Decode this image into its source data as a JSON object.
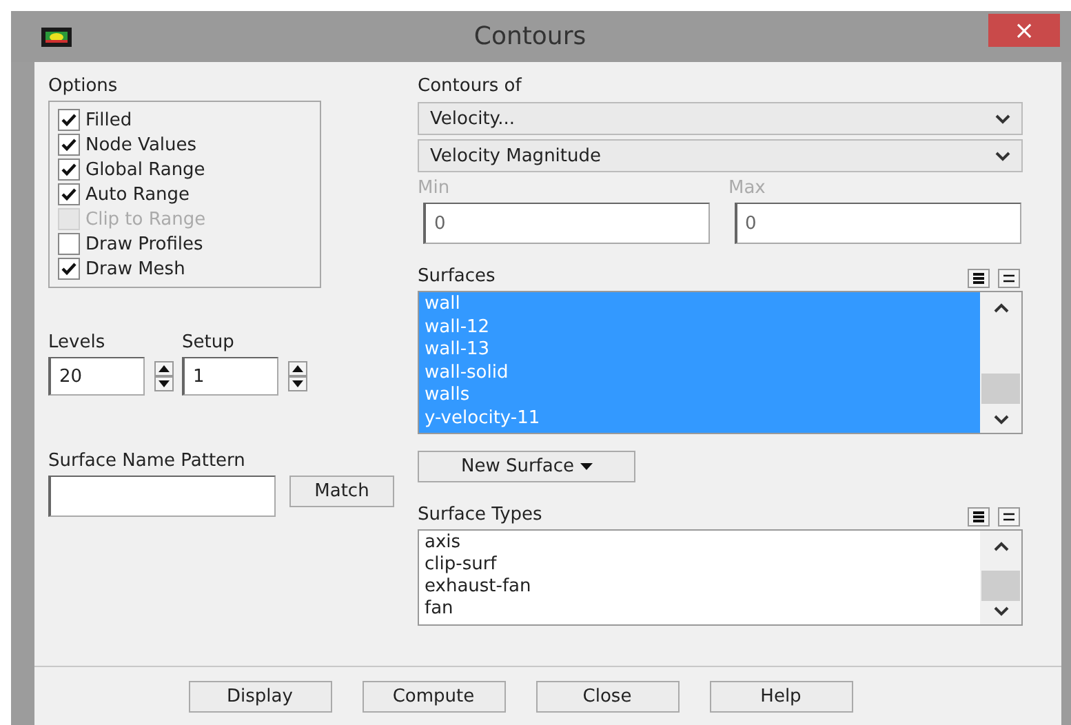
{
  "window": {
    "title": "Contours",
    "close": "×"
  },
  "options": {
    "label": "Options",
    "items": [
      {
        "label": "Filled",
        "checked": true,
        "disabled": false
      },
      {
        "label": "Node Values",
        "checked": true,
        "disabled": false
      },
      {
        "label": "Global Range",
        "checked": true,
        "disabled": false
      },
      {
        "label": "Auto Range",
        "checked": true,
        "disabled": false
      },
      {
        "label": "Clip to Range",
        "checked": false,
        "disabled": true
      },
      {
        "label": "Draw Profiles",
        "checked": false,
        "disabled": false
      },
      {
        "label": "Draw Mesh",
        "checked": true,
        "disabled": false
      }
    ]
  },
  "levels": {
    "label": "Levels",
    "value": "20"
  },
  "setup": {
    "label": "Setup",
    "value": "1"
  },
  "surface_name_pattern": {
    "label": "Surface Name Pattern",
    "button": "Match"
  },
  "contours_of": {
    "label": "Contours of",
    "quantity": "Velocity...",
    "component": "Velocity Magnitude"
  },
  "min": {
    "label": "Min",
    "value": "0"
  },
  "max": {
    "label": "Max",
    "value": "0"
  },
  "surfaces": {
    "label": "Surfaces",
    "items": [
      {
        "label": "wall",
        "selected": true
      },
      {
        "label": "wall-12",
        "selected": true
      },
      {
        "label": "wall-13",
        "selected": true
      },
      {
        "label": "wall-solid",
        "selected": true
      },
      {
        "label": "walls",
        "selected": true
      },
      {
        "label": "y-velocity-11",
        "selected": true
      }
    ]
  },
  "new_surface": {
    "label": "New Surface"
  },
  "surface_types": {
    "label": "Surface Types",
    "items": [
      {
        "label": "axis",
        "selected": false
      },
      {
        "label": "clip-surf",
        "selected": false
      },
      {
        "label": "exhaust-fan",
        "selected": false
      },
      {
        "label": "fan",
        "selected": false
      }
    ]
  },
  "buttons": [
    "Display",
    "Compute",
    "Close",
    "Help"
  ]
}
